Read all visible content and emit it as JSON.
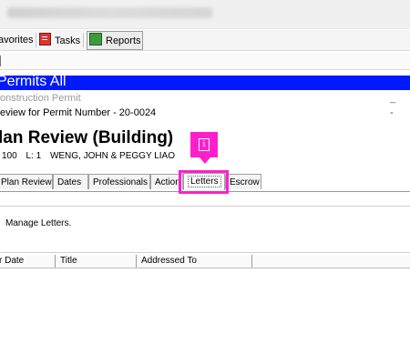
{
  "toolbar": {
    "items": [
      "avorites",
      "Tasks",
      "Reports"
    ]
  },
  "banner": {
    "title": "Permits All"
  },
  "window": {
    "subtitle": "onstruction Permit",
    "minimize": "_",
    "review_line": "eview for Permit Number - 20-0024",
    "review_minus": "-"
  },
  "header": {
    "title": "lan Review (Building)",
    "sub": {
      "num": "100",
      "lot": "L: 1",
      "owner": "WENG, JOHN & PEGGY LIAO"
    }
  },
  "tabs": [
    {
      "label": "Plan Review"
    },
    {
      "label": "Dates"
    },
    {
      "label": "Professionals"
    },
    {
      "label": "Action"
    },
    {
      "label": "Letters",
      "active": true
    },
    {
      "label": "Escrow"
    }
  ],
  "callout": {
    "glyph": "i"
  },
  "panel": {
    "message": "Manage Letters."
  },
  "grid": {
    "columns": [
      "r Date",
      "Title",
      "Addressed To"
    ]
  },
  "colors": {
    "banner": "#0019ff",
    "highlight": "#ff1fcc"
  }
}
